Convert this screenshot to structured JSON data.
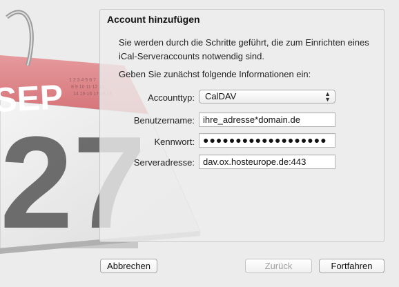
{
  "calendar": {
    "month": "SEP",
    "day": "27"
  },
  "dialog": {
    "title": "Account hinzufügen",
    "intro": "Sie werden durch die Schritte geführt, die zum Einrichten eines iCal-Serveraccounts notwendig sind.",
    "prompt": "Geben Sie zunächst folgende Informationen ein:"
  },
  "form": {
    "account_type": {
      "label": "Accounttyp:",
      "value": "CalDAV"
    },
    "username": {
      "label": "Benutzername:",
      "value": "ihre_adresse*domain.de"
    },
    "password": {
      "label": "Kennwort:",
      "value": "●●●●●●●●●●●●●●●●●●●"
    },
    "server": {
      "label": "Serveradresse:",
      "value": "dav.ox.hosteurope.de:443"
    }
  },
  "buttons": {
    "cancel": "Abbrechen",
    "back": "Zurück",
    "continue": "Fortfahren"
  }
}
